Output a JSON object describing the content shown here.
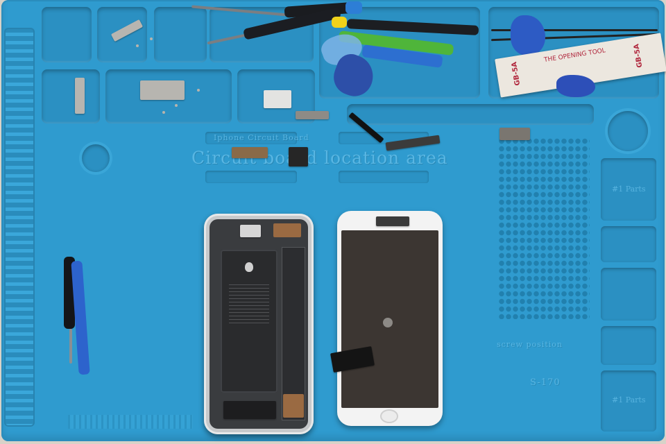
{
  "mat": {
    "main_label": "Circuit board location area",
    "plate_label": "Iphone Circuit Board",
    "plate_sub_left": "",
    "plate_sub_right": "",
    "screw_label": "screw position",
    "size_label": "S-170",
    "size_dims": "",
    "brand_small": ""
  },
  "side_trays": [
    {
      "label": "#1 Parts"
    },
    {
      "label": ""
    },
    {
      "label": ""
    },
    {
      "label": ""
    },
    {
      "label": "#1 Parts"
    }
  ],
  "tool_box": {
    "model_left": "GB-5A",
    "model_right": "GB-5A",
    "caption": "THE OPENING TOOL"
  },
  "colors": {
    "mat": "#2f9bcf",
    "mat_shadow": "#2b90c2",
    "embossed_text": "#58b6e3",
    "handle_blue": "#2d6fd0",
    "handle_green": "#4fb53a",
    "handle_yellow": "#f0d21a"
  },
  "objects": {
    "open_iphone": "opened-iphone-body",
    "display_assembly": "detached-display",
    "battery_logo": "apple-logo-icon"
  }
}
